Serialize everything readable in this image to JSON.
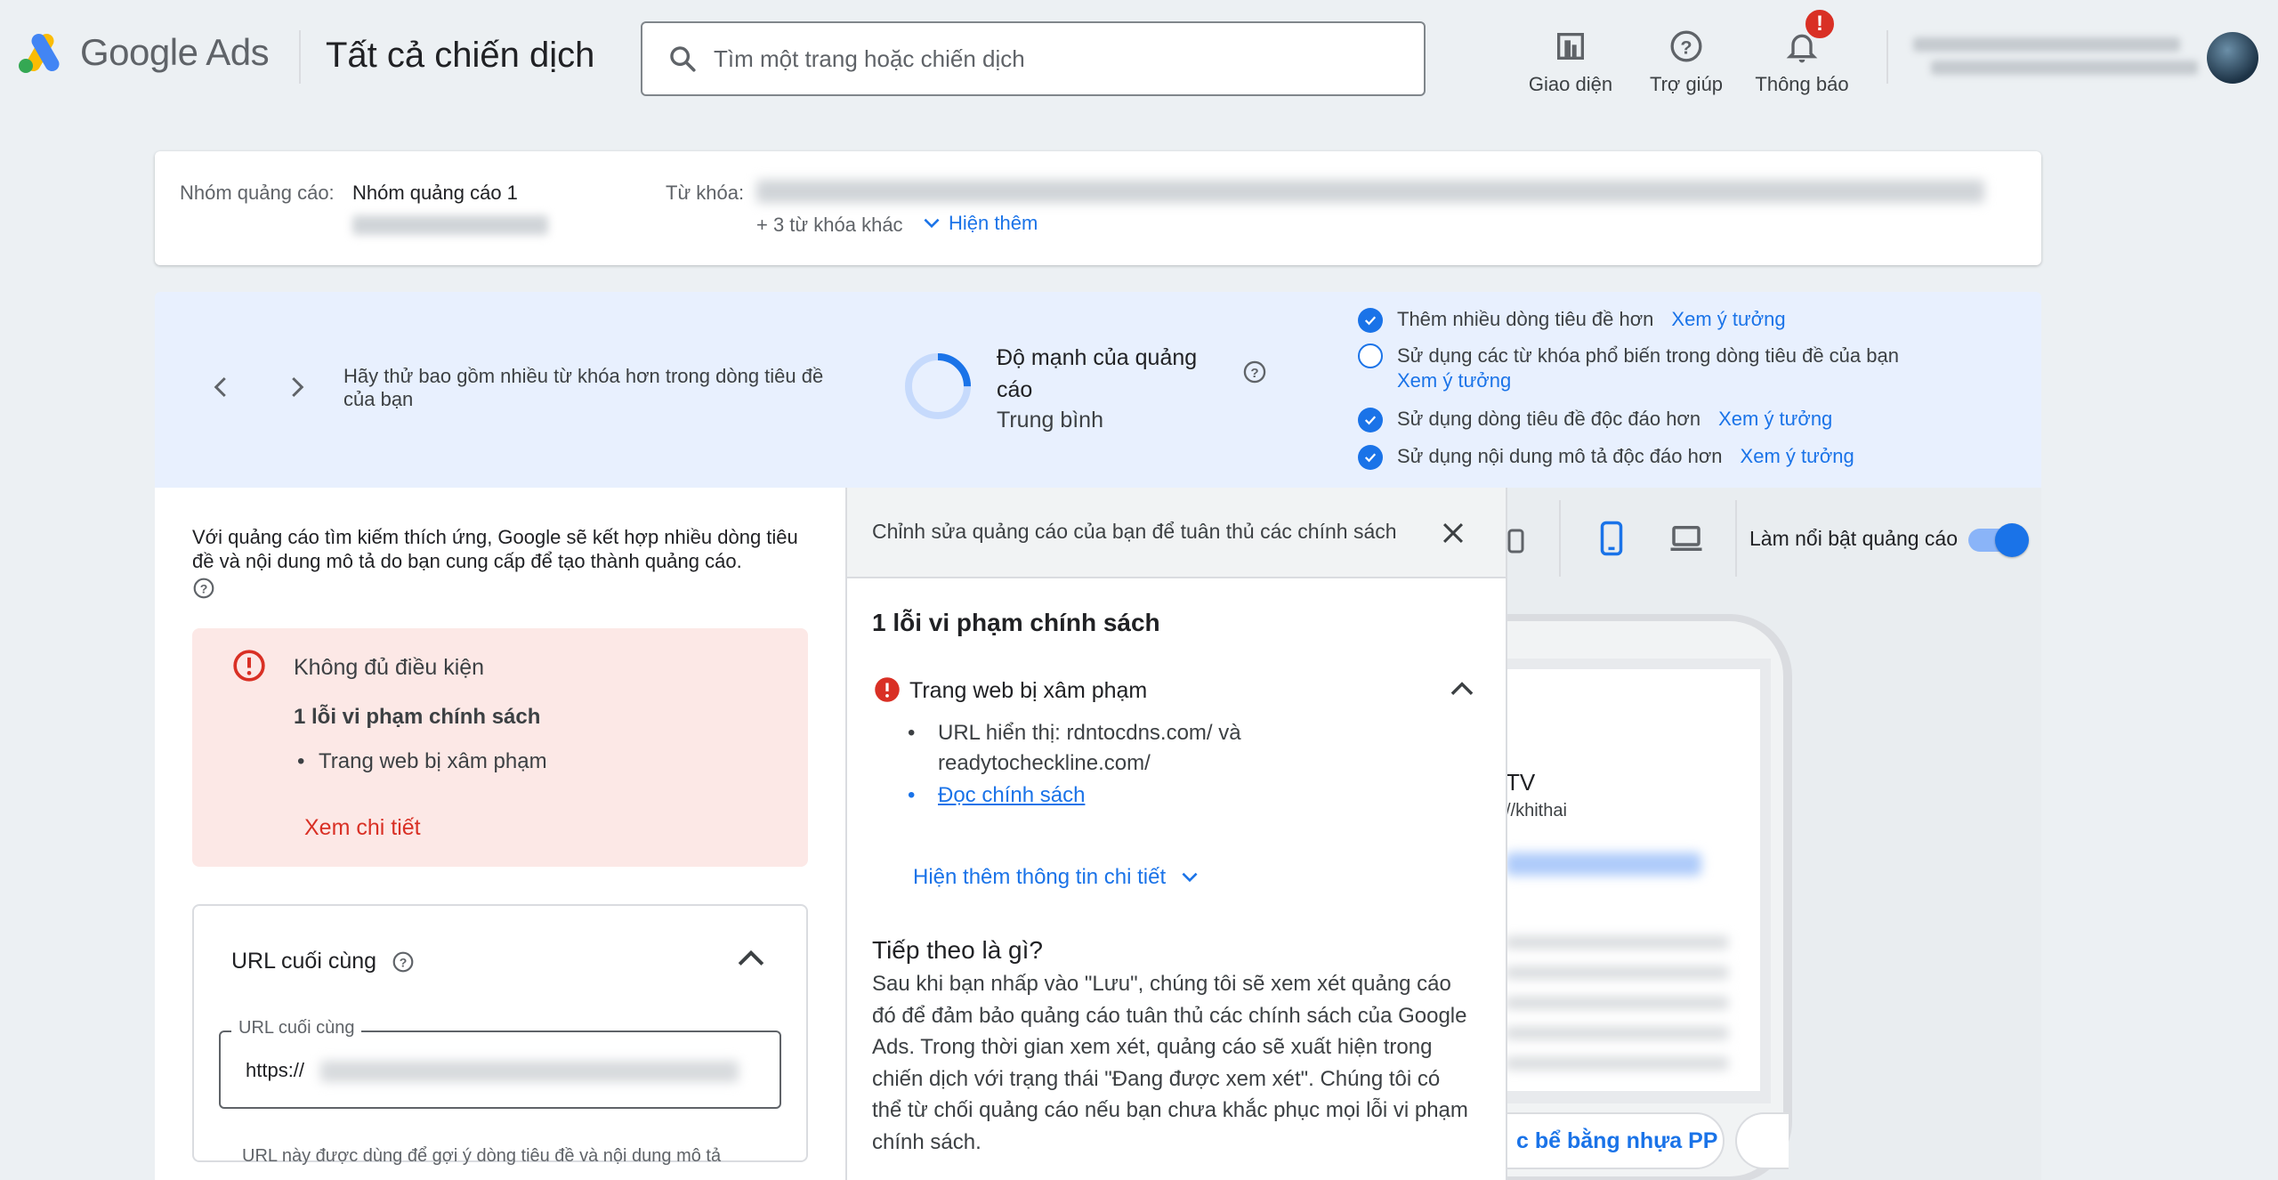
{
  "app": {
    "brand": "Google Ads",
    "page_title": "Tất cả chiến dịch"
  },
  "search": {
    "placeholder": "Tìm một trang hoặc chiến dịch"
  },
  "top_actions": {
    "appearance": "Giao diện",
    "help": "Trợ giúp",
    "notifications": "Thông báo",
    "notif_badge": "!"
  },
  "info": {
    "adgroup_label": "Nhóm quảng cáo:",
    "adgroup_value": "Nhóm quảng cáo 1",
    "keywords_label": "Từ khóa:",
    "more_keywords": "+ 3 từ khóa khác",
    "show_more": "Hiện thêm"
  },
  "strength": {
    "tip": "Hãy thử bao gồm nhiều từ khóa hơn trong dòng tiêu đề của bạn",
    "title": "Độ mạnh của quảng cáo",
    "level": "Trung bình",
    "level_fraction": 0.25,
    "checklist": [
      {
        "text": "Thêm nhiều dòng tiêu đề hơn",
        "link": "Xem ý tưởng",
        "checked": true
      },
      {
        "text": "Sử dụng các từ khóa phổ biến trong dòng tiêu đề của bạn",
        "link": "Xem ý tưởng",
        "checked": false
      },
      {
        "text": "Sử dụng dòng tiêu đề độc đáo hơn",
        "link": "Xem ý tưởng",
        "checked": true
      },
      {
        "text": "Sử dụng nội dung mô tả độc đáo hơn",
        "link": "Xem ý tưởng",
        "checked": true
      }
    ]
  },
  "left": {
    "intro": "Với quảng cáo tìm kiếm thích ứng, Google sẽ kết hợp nhiều dòng tiêu đề và nội dung mô tả do bạn cung cấp để tạo thành quảng cáo.",
    "error": {
      "status": "Không đủ điều kiện",
      "count": "1 lỗi vi phạm chính sách",
      "item": "Trang web bị xâm phạm",
      "details_link": "Xem chi tiết"
    },
    "final_url": {
      "title": "URL cuối cùng",
      "field_label": "URL cuối cùng",
      "value_prefix": "https://",
      "helper": "URL này được dùng để gợi ý dòng tiêu đề và nội dung mô tả"
    }
  },
  "policy": {
    "header": "Chỉnh sửa quảng cáo của bạn để tuân thủ các chính sách",
    "title": "1 lỗi vi phạm chính sách",
    "violation": "Trang web bị xâm phạm",
    "display_url_1": "URL hiển thị: rdntocdns.com/ và",
    "display_url_2": "readytocheckline.com/",
    "read_policy": "Đọc chính sách",
    "show_more": "Hiện thêm thông tin chi tiết",
    "next_title": "Tiếp theo là gì?",
    "next_body": "Sau khi bạn nhấp vào \"Lưu\", chúng tôi sẽ xem xét quảng cáo đó để đảm bảo quảng cáo tuân thủ các chính sách của Google Ads. Trong thời gian xem xét, quảng cáo sẽ xuất hiện trong chiến dịch với trạng thái \"Đang được xem xét\". Chúng tôi có thể từ chối quảng cáo nếu bạn chưa khắc phục mọi lỗi vi phạm chính sách."
  },
  "preview": {
    "highlight_label": "Làm nổi bật quảng cáo",
    "highlight_on": true,
    "ad_partial_title": "TV",
    "ad_partial_url": "//khithai",
    "sitelink_partial": "c bể bằng nhựa PP"
  },
  "colors": {
    "accent": "#1a73e8",
    "error": "#d93025",
    "error_bg": "#fce8e6",
    "banner_bg": "#e8f0fe"
  }
}
